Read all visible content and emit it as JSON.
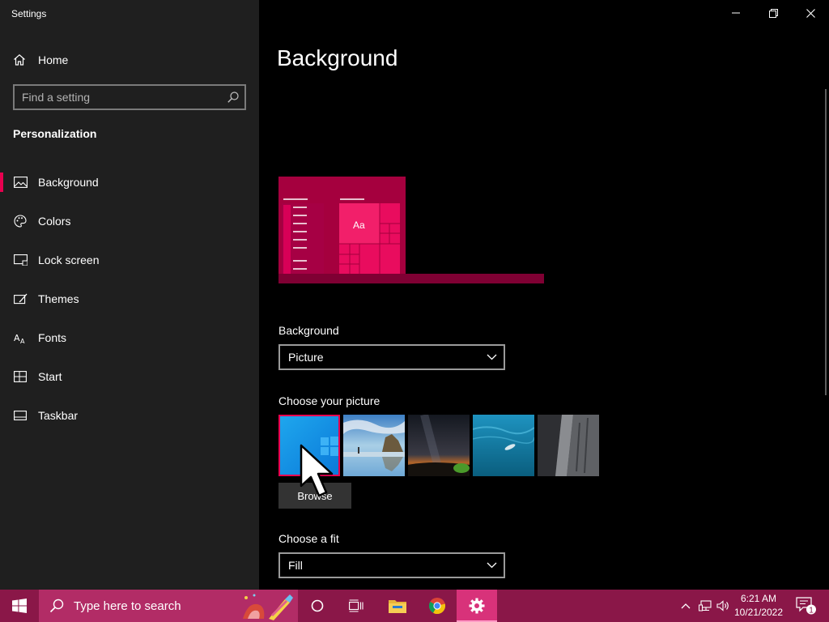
{
  "window": {
    "title": "Settings",
    "controls": [
      "minimize",
      "restore",
      "close"
    ]
  },
  "sidebar": {
    "home_label": "Home",
    "search_placeholder": "Find a setting",
    "section_title": "Personalization",
    "items": [
      {
        "label": "Background",
        "icon": "picture-icon",
        "active": true
      },
      {
        "label": "Colors",
        "icon": "palette-icon",
        "active": false
      },
      {
        "label": "Lock screen",
        "icon": "lock-screen-icon",
        "active": false
      },
      {
        "label": "Themes",
        "icon": "brush-icon",
        "active": false
      },
      {
        "label": "Fonts",
        "icon": "font-icon",
        "active": false
      },
      {
        "label": "Start",
        "icon": "start-grid-icon",
        "active": false
      },
      {
        "label": "Taskbar",
        "icon": "taskbar-icon",
        "active": false
      }
    ]
  },
  "main": {
    "page_title": "Background",
    "preview": {
      "sample_text": "Aa"
    },
    "background_label": "Background",
    "background_value": "Picture",
    "choose_picture_label": "Choose your picture",
    "pictures": [
      "windows-blue",
      "rock-arch-beach",
      "milky-way-desert",
      "underwater-swimmer",
      "rock-cliff-face"
    ],
    "browse_label": "Browse",
    "fit_label": "Choose a fit",
    "fit_value": "Fill"
  },
  "taskbar": {
    "search_placeholder": "Type here to search",
    "pinned": [
      "cortana-icon",
      "task-view-icon",
      "file-explorer-icon",
      "chrome-icon",
      "settings-icon"
    ],
    "clock_time": "6:21 AM",
    "clock_date": "10/21/2022",
    "notification_count": "1"
  },
  "colors": {
    "accent": "#e8004f",
    "sidebar_bg": "#1f1f1f",
    "taskbar_bg": "#8a1748"
  }
}
